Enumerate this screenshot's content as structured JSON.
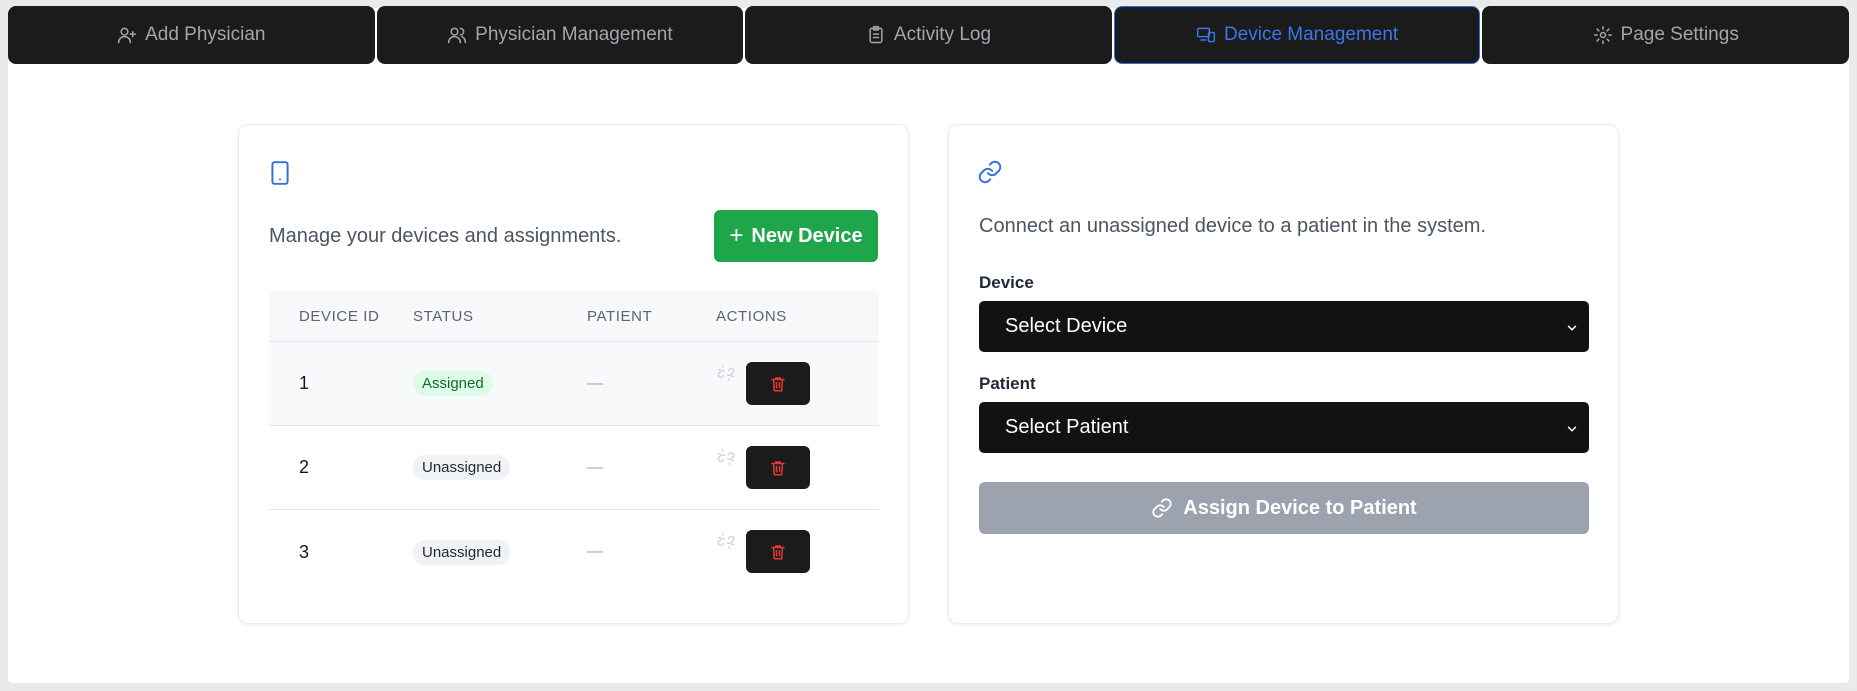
{
  "tabs": [
    {
      "label": "Add Physician",
      "icon": "user-plus-icon",
      "active": false
    },
    {
      "label": "Physician Management",
      "icon": "users-icon",
      "active": false
    },
    {
      "label": "Activity Log",
      "icon": "clipboard-icon",
      "active": false
    },
    {
      "label": "Device Management",
      "icon": "devices-icon",
      "active": true
    },
    {
      "label": "Page Settings",
      "icon": "gear-icon",
      "active": false
    }
  ],
  "devices_card": {
    "icon": "tablet-icon",
    "description": "Manage your devices and assignments.",
    "new_button_label": "New Device",
    "columns": [
      "DEVICE ID",
      "STATUS",
      "PATIENT",
      "ACTIONS"
    ],
    "rows": [
      {
        "id": "1",
        "status": "Assigned",
        "patient": "—"
      },
      {
        "id": "2",
        "status": "Unassigned",
        "patient": "—"
      },
      {
        "id": "3",
        "status": "Unassigned",
        "patient": "—"
      }
    ]
  },
  "assign_card": {
    "icon": "link-icon",
    "description": "Connect an unassigned device to a patient in the system.",
    "device_label": "Device",
    "device_value": "Select Device",
    "patient_label": "Patient",
    "patient_value": "Select Patient",
    "assign_button_label": "Assign Device to Patient"
  },
  "colors": {
    "accent": "#2f6fe0",
    "success": "#1fa64b",
    "danger": "#e53935",
    "disabled": "#9ca3af"
  }
}
